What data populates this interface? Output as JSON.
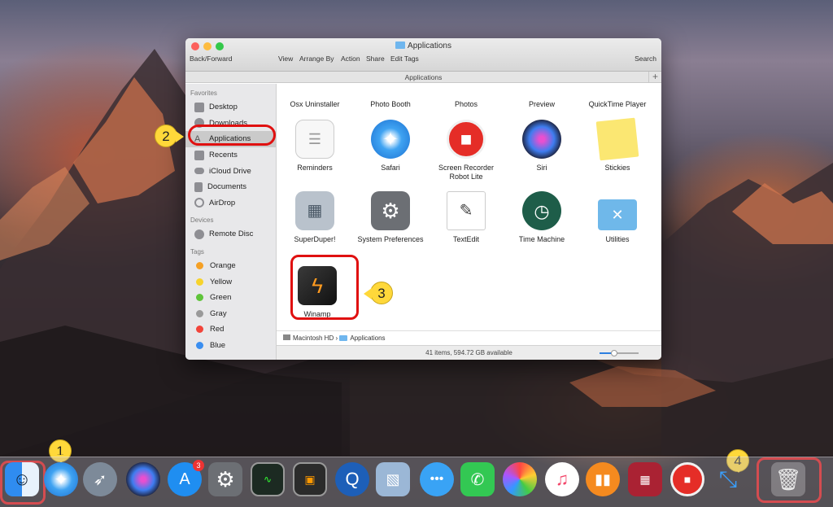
{
  "window": {
    "title": "Applications",
    "toolbar": {
      "back_forward": "Back/Forward",
      "view": "View",
      "arrange_by": "Arrange By",
      "action": "Action",
      "share": "Share",
      "edit_tags": "Edit Tags",
      "search": "Search"
    },
    "path_title": "Applications",
    "plus": "+"
  },
  "sidebar": {
    "favorites_header": "Favorites",
    "favorites": [
      "Desktop",
      "Downloads",
      "Applications",
      "Recents",
      "iCloud Drive",
      "Documents",
      "AirDrop"
    ],
    "devices_header": "Devices",
    "devices": [
      "Remote Disc"
    ],
    "tags_header": "Tags",
    "tags": [
      {
        "label": "Orange",
        "color": "#f5a024"
      },
      {
        "label": "Yellow",
        "color": "#f7d32c"
      },
      {
        "label": "Green",
        "color": "#5fc43a"
      },
      {
        "label": "Gray",
        "color": "#9a9a9a"
      },
      {
        "label": "Red",
        "color": "#f2443a"
      },
      {
        "label": "Blue",
        "color": "#3b8ef0"
      }
    ]
  },
  "apps": [
    {
      "label": "Osx Uninstaller"
    },
    {
      "label": "Photo Booth"
    },
    {
      "label": "Photos"
    },
    {
      "label": "Preview"
    },
    {
      "label": "QuickTime Player"
    },
    {
      "label": "Reminders"
    },
    {
      "label": "Safari"
    },
    {
      "label": "Screen Recorder Robot Lite"
    },
    {
      "label": "Siri"
    },
    {
      "label": "Stickies"
    },
    {
      "label": "SuperDuper!"
    },
    {
      "label": "System Preferences"
    },
    {
      "label": "TextEdit"
    },
    {
      "label": "Time Machine"
    },
    {
      "label": "Utilities"
    },
    {
      "label": "Winamp"
    }
  ],
  "statusbar": {
    "path_disk": "Macintosh HD",
    "path_sep": "›",
    "path_folder": "Applications",
    "summary": "41 items, 594.72 GB available"
  },
  "annotations": {
    "step1": "1",
    "step2": "2",
    "step3": "3",
    "step4": "4"
  },
  "dock": {
    "app_store_badge": "3"
  }
}
